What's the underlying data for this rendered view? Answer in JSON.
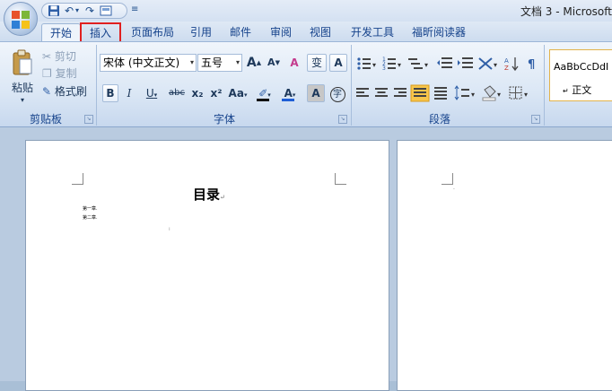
{
  "window": {
    "title": "文档 3 - Microsoft"
  },
  "quick_access": {
    "items": [
      "save-icon",
      "undo-icon",
      "redo-icon",
      "print-preview-icon",
      "customize-icon"
    ]
  },
  "tabs": [
    {
      "label": "开始"
    },
    {
      "label": "插入"
    },
    {
      "label": "页面布局"
    },
    {
      "label": "引用"
    },
    {
      "label": "邮件"
    },
    {
      "label": "审阅"
    },
    {
      "label": "视图"
    },
    {
      "label": "开发工具"
    },
    {
      "label": "福昕阅读器"
    }
  ],
  "clipboard": {
    "paste": "粘贴",
    "cut": "剪切",
    "copy": "复制",
    "format_painter": "格式刷",
    "group_label": "剪贴板"
  },
  "font": {
    "font_name": "宋体 (中文正文)",
    "font_size": "五号",
    "grow": "A",
    "shrink": "A",
    "clear_format": "A",
    "phonetic": "变",
    "border": "A",
    "bold": "B",
    "italic": "I",
    "underline": "U",
    "strike": "abc",
    "subscript": "x₂",
    "superscript": "x²",
    "case": "Aa",
    "font_color": "A",
    "shading": "A",
    "enclose": "字",
    "group_label": "字体"
  },
  "paragraph": {
    "group_label": "段落"
  },
  "styles": {
    "sample": "AaBbCcDdI",
    "name": "正文"
  },
  "document": {
    "toc_title": "目录",
    "chapters": [
      "第一章.",
      "第二章."
    ]
  },
  "colors": {
    "accent": "#15428b",
    "highlight_border": "#e02020",
    "ribbon_bg": "#dbe7f5"
  }
}
